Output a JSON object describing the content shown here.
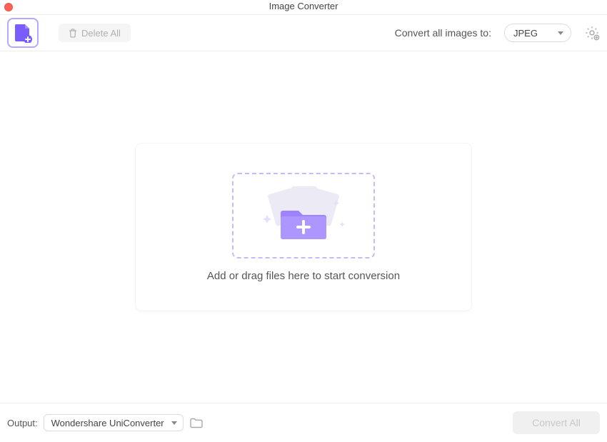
{
  "titlebar": {
    "title": "Image Converter"
  },
  "toolbar": {
    "delete_all_label": "Delete All",
    "convert_to_label": "Convert all images to:",
    "format_selected": "JPEG"
  },
  "dropzone": {
    "hint": "Add or drag files here to start conversion"
  },
  "footer": {
    "output_label": "Output:",
    "output_path_selected": "Wondershare UniConverter",
    "convert_all_label": "Convert All"
  }
}
